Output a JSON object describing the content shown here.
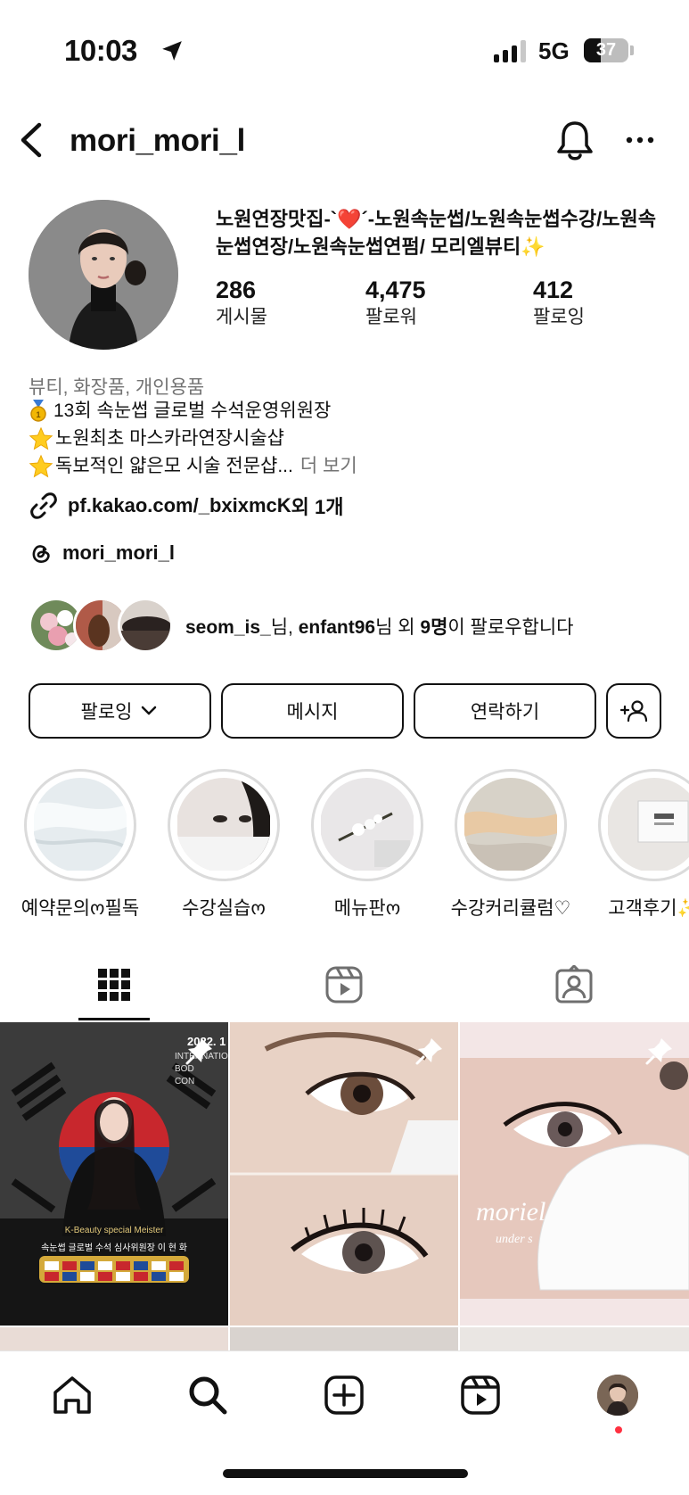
{
  "status_bar": {
    "time": "10:03",
    "network": "5G",
    "battery": "37",
    "battery_level": 0.37
  },
  "header": {
    "username": "mori_mori_l",
    "back_icon": "chevron-left-icon",
    "bell_icon": "bell-icon",
    "more_icon": "more-horizontal-icon"
  },
  "profile": {
    "bio_title": "노원연장맛집-`❤️´-노원속눈썹/노원속눈썹수강/노원속눈썹연장/노원속눈썹연펌/ 모리엘뷰티✨",
    "stats": [
      {
        "value": "286",
        "label": "게시물"
      },
      {
        "value": "4,475",
        "label": "팔로워"
      },
      {
        "value": "412",
        "label": "팔로잉"
      }
    ],
    "category": "뷰티, 화장품, 개인용품",
    "bio_lines": [
      "13회 속눈썹 글로벌 수석운영위원장",
      "노원최초 마스카라연장시술샵",
      "독보적인 얇은모 시술 전문샵..."
    ],
    "more_label": "더 보기",
    "link": "pf.kakao.com/_bxixmcK",
    "link_more": " 외 1개",
    "threads_handle": "mori_mori_l",
    "followed_by": {
      "user1": "seom_is_",
      "sep1": "님, ",
      "user2": "enfant96",
      "sep2": "님 외 ",
      "count": "9명",
      "tail": "이 팔로우합니다"
    }
  },
  "actions": {
    "following": "팔로잉",
    "message": "메시지",
    "contact": "연락하기"
  },
  "highlights": [
    {
      "label": "예약문의ო필독"
    },
    {
      "label": "수강실습ო"
    },
    {
      "label": "메뉴판ო"
    },
    {
      "label": "수강커리큘럼♡"
    },
    {
      "label": "고객후기✨"
    }
  ],
  "tabs": [
    "grid-icon",
    "reels-icon",
    "tagged-icon"
  ],
  "posts": {
    "post1": {
      "year": "2022. 1",
      "heading_lines": [
        "INTERNATIO",
        "BOD",
        "CON"
      ],
      "subtitle": "K-Beauty special Meister",
      "caption": "속눈썹 글로벌 수석 심사위원장 이 현 화"
    },
    "post3": {
      "overlay": "moriel",
      "overlay_sub": "under s"
    }
  },
  "bottom_nav": [
    "home-icon",
    "search-icon",
    "create-icon",
    "reels-icon",
    "profile-avatar"
  ]
}
